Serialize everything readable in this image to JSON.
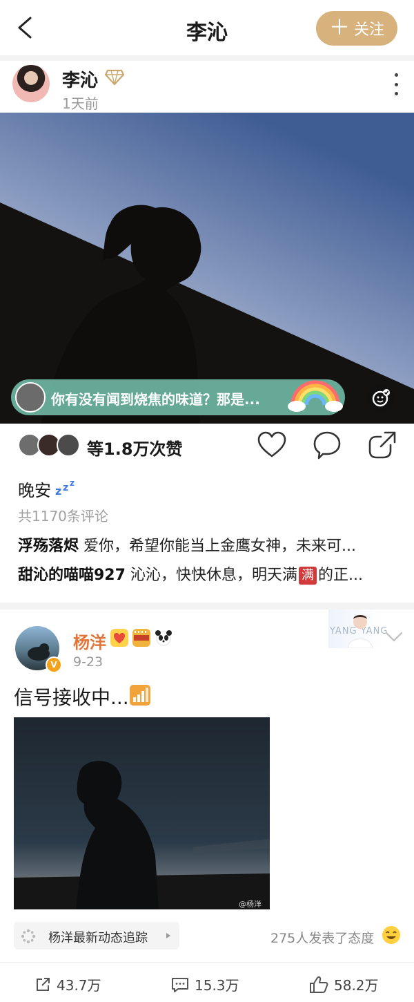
{
  "header": {
    "title": "李沁",
    "follow_label": "关注"
  },
  "post1": {
    "author": "李沁",
    "time": "1天前",
    "caption": "你有没有闻到烧焦的味道？那是...",
    "likes_text": "等1.8万次赞",
    "text": "晚安",
    "comment_count": "共1170条评论",
    "comments": [
      {
        "user": "浮殇落烬",
        "text": "爱你，希望你能当上金鹰女神，未来可..."
      },
      {
        "user": "甜沁的喵喵927",
        "text_before": "沁沁，快快休息，明天满",
        "badge": "满",
        "text_after": "的正..."
      }
    ]
  },
  "post2": {
    "author": "杨洋",
    "time": "9-23",
    "text": "信号接收中...",
    "ad_text": "YANG YANG",
    "watermark": "@杨洋",
    "tracker": "杨洋最新动态追踪",
    "attitude": "275人发表了态度",
    "stats": {
      "reposts": "43.7万",
      "comments": "15.3万",
      "likes": "58.2万"
    }
  },
  "colors": {
    "follow_button": "#d8b27c",
    "author2_name": "#e0763a",
    "caption_bar": "#73beaa"
  },
  "icons": [
    "back-icon",
    "vip-diamond-icon",
    "more-icon",
    "rainbow-icon",
    "emoji-react-icon",
    "heart-icon",
    "comment-icon",
    "share-icon",
    "zzz-icon",
    "verified-badge-icon",
    "signal-icon",
    "chevron-down-icon",
    "tracker-icon",
    "smile-icon",
    "repost-icon",
    "like-icon"
  ]
}
